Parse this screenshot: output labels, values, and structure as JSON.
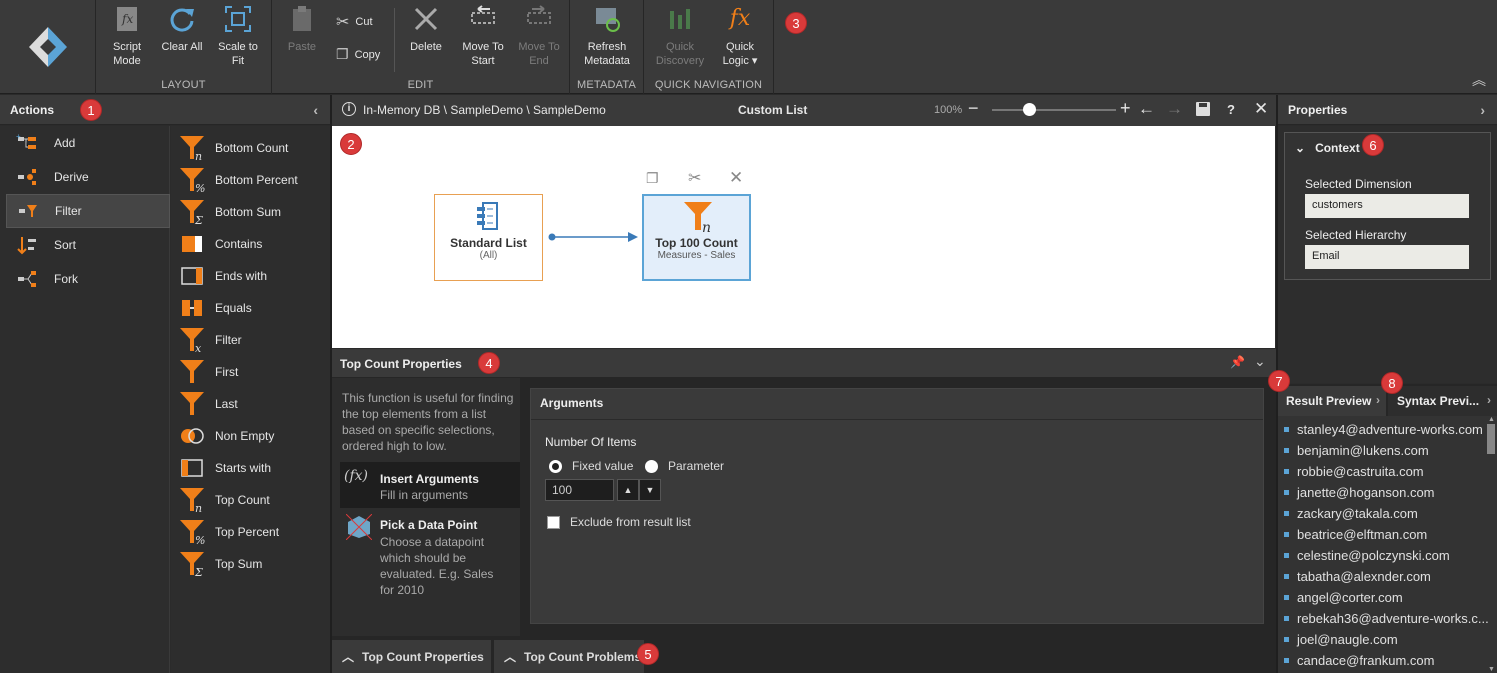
{
  "ribbon": {
    "layout": {
      "label": "LAYOUT",
      "script_mode": "Script\nMode",
      "clear_all": "Clear All",
      "scale_to_fit": "Scale to\nFit"
    },
    "edit": {
      "label": "EDIT",
      "paste": "Paste",
      "cut": "Cut",
      "copy": "Copy",
      "delete": "Delete",
      "move_to_start": "Move To\nStart",
      "move_to_end": "Move To\nEnd"
    },
    "metadata": {
      "label": "METADATA",
      "refresh": "Refresh\nMetadata"
    },
    "quick_nav": {
      "label": "QUICK NAVIGATION",
      "quick_discovery": "Quick\nDiscovery",
      "quick_logic": "Quick\nLogic ▾"
    }
  },
  "badges": [
    "1",
    "2",
    "3",
    "4",
    "5",
    "6",
    "7",
    "8"
  ],
  "actions": {
    "title": "Actions",
    "items": [
      "Add",
      "Derive",
      "Filter",
      "Sort",
      "Fork"
    ],
    "selected": "Filter"
  },
  "filters": [
    "Bottom Count",
    "Bottom Percent",
    "Bottom Sum",
    "Contains",
    "Ends with",
    "Equals",
    "Filter",
    "First",
    "Last",
    "Non Empty",
    "Starts with",
    "Top Count",
    "Top Percent",
    "Top Sum"
  ],
  "canvas": {
    "breadcrumb": "In-Memory DB \\ SampleDemo \\ SampleDemo",
    "title": "Custom List",
    "zoom": "100%",
    "zoom_level": 0.3,
    "node1_title": "Standard List",
    "node1_sub": "(All)",
    "node2_title": "Top 100 Count",
    "node2_sub": "Measures - Sales"
  },
  "props_panel": {
    "title": "Top Count Properties",
    "description": "This function is useful for finding the top elements from a list based on specific selections, ordered high to low.",
    "insert_title": "Insert Arguments",
    "insert_sub": "Fill in arguments",
    "pick_title": "Pick a Data Point",
    "pick_sub": "Choose a datapoint which should be evaluated. E.g. Sales for 2010",
    "arguments": "Arguments",
    "number_of_items": "Number Of Items",
    "fixed_value": "Fixed value",
    "parameter": "Parameter",
    "value": "100",
    "exclude": "Exclude from result list"
  },
  "bottom_tabs": [
    "Top Count Properties",
    "Top Count Problems"
  ],
  "properties": {
    "title": "Properties",
    "context": "Context",
    "dim_label": "Selected Dimension",
    "dim_value": "customers",
    "hier_label": "Selected Hierarchy",
    "hier_value": "Email"
  },
  "preview": {
    "tab1": "Result Preview",
    "tab2": "Syntax Previ...",
    "emails": [
      "stanley4@adventure-works.com",
      "benjamin@lukens.com",
      "robbie@castruita.com",
      "janette@hoganson.com",
      "zackary@takala.com",
      "beatrice@elftman.com",
      "celestine@polczynski.com",
      "tabatha@alexnder.com",
      "angel@corter.com",
      "rebekah36@adventure-works.c...",
      "joel@naugle.com",
      "candace@frankum.com"
    ]
  },
  "colors": {
    "accent": "#f07f19",
    "selection": "#5ba4d6",
    "badge": "#d93a3a"
  }
}
